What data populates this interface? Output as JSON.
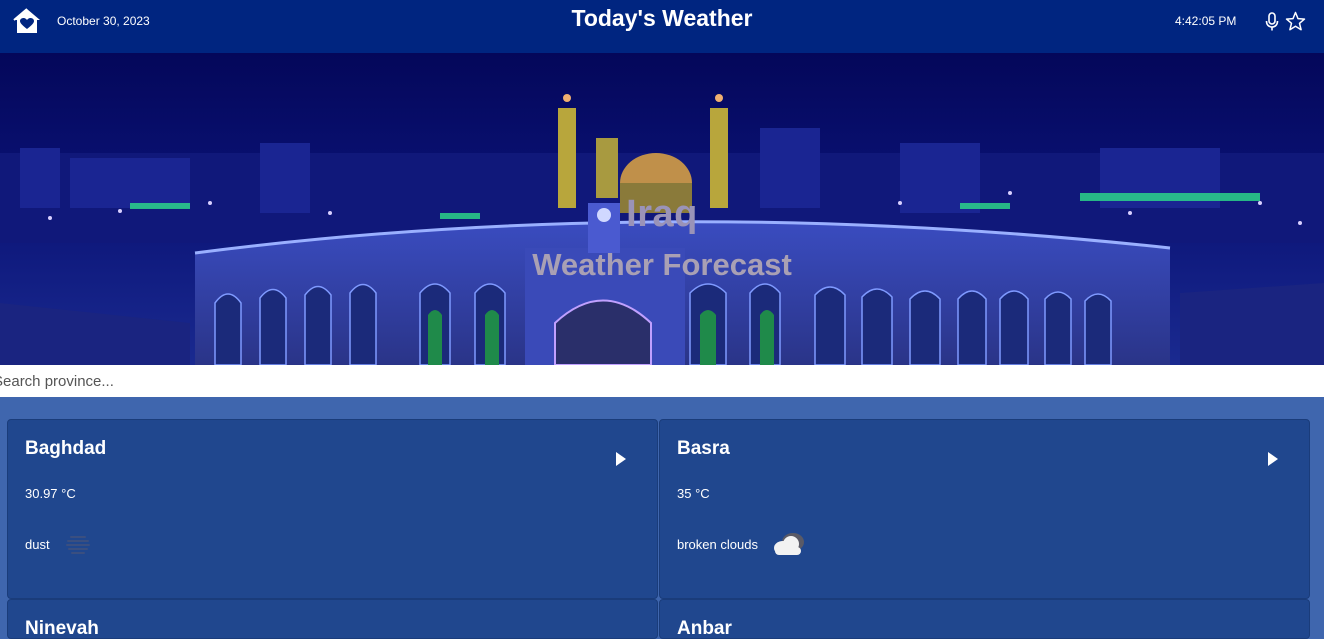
{
  "header": {
    "date": "October 30, 2023",
    "title": "Today's Weather",
    "time": "4:42:05 PM",
    "icons": [
      "home-icon",
      "microphone-icon",
      "star-icon"
    ]
  },
  "hero": {
    "title": "Iraq",
    "subtitle": "Weather Forecast"
  },
  "search": {
    "placeholder": "Search province..."
  },
  "provinces": [
    {
      "name": "Baghdad",
      "temp": "30.97 °C",
      "description": "dust",
      "icon": "dust-icon"
    },
    {
      "name": "Basra",
      "temp": "35 °C",
      "description": "broken clouds",
      "icon": "broken-clouds-icon"
    },
    {
      "name": "Ninevah"
    },
    {
      "name": "Anbar"
    }
  ],
  "colors": {
    "header_bg": "#002580",
    "page_bg": "#3f66ae",
    "card_bg": "#20478e"
  }
}
